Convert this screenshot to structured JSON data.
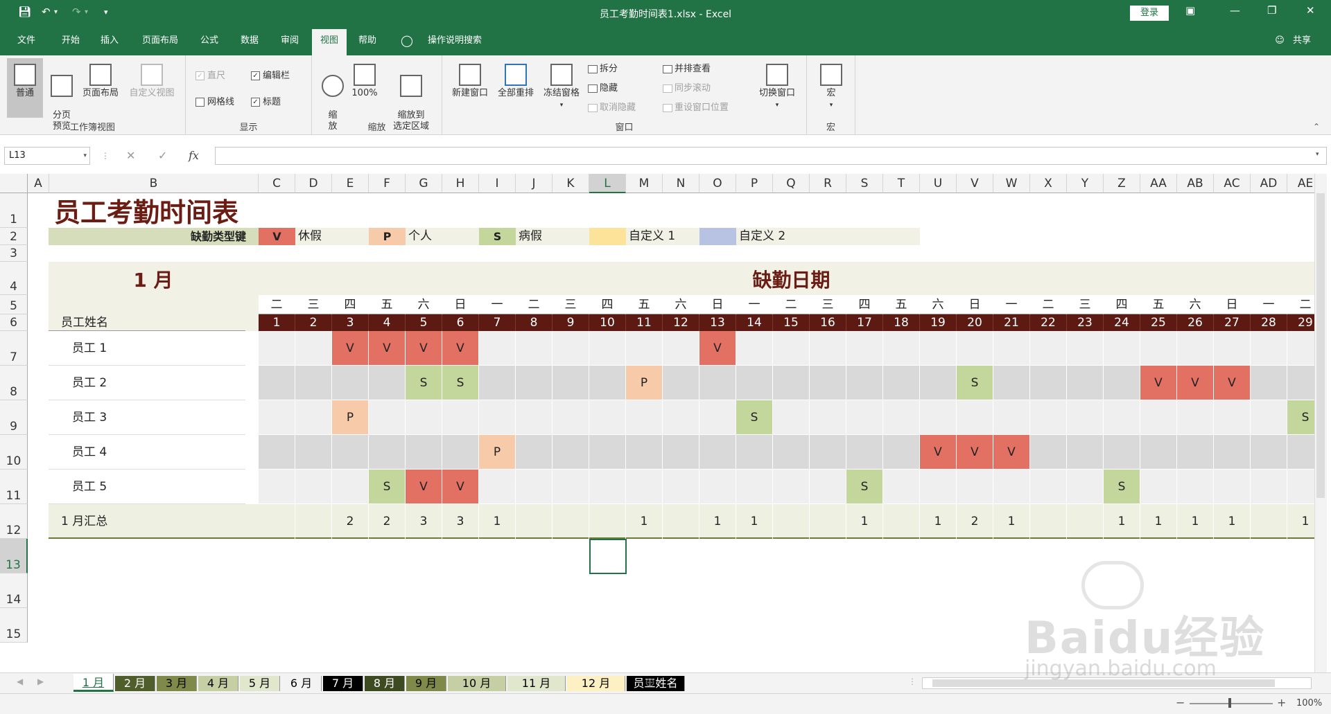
{
  "window": {
    "title": "员工考勤时间表1.xlsx  -  Excel",
    "login": "登录",
    "share": "共享"
  },
  "ribbon_tabs": [
    "文件",
    "开始",
    "插入",
    "页面布局",
    "公式",
    "数据",
    "审阅",
    "视图",
    "帮助"
  ],
  "tell_me": "操作说明搜索",
  "ribbon": {
    "workbook_views": {
      "label": "工作簿视图",
      "normal": "普通",
      "page_break": "分页\n预览",
      "page_layout": "页面布局",
      "custom_views": "自定义视图"
    },
    "show": {
      "label": "显示",
      "ruler": "直尺",
      "formula_bar": "编辑栏",
      "gridlines": "网格线",
      "headings": "标题"
    },
    "zoom": {
      "label": "缩放",
      "zoom": "缩\n放",
      "zoom100": "100%",
      "zoom_sel": "缩放到\n选定区域"
    },
    "window": {
      "label": "窗口",
      "new_window": "新建窗口",
      "arrange_all": "全部重排",
      "freeze": "冻结窗格",
      "split": "拆分",
      "hide": "隐藏",
      "unhide": "取消隐藏",
      "side_by_side": "并排查看",
      "sync_scroll": "同步滚动",
      "reset_pos": "重设窗口位置",
      "switch": "切换窗口"
    },
    "macros": {
      "label": "宏",
      "macros": "宏"
    }
  },
  "formula_bar": {
    "name_box": "L13",
    "fx": "fx",
    "value": ""
  },
  "sheet": {
    "columns": [
      "A",
      "B",
      "C",
      "D",
      "E",
      "F",
      "G",
      "H",
      "I",
      "J",
      "K",
      "L",
      "M",
      "N",
      "O",
      "P",
      "Q",
      "R",
      "S",
      "T",
      "U",
      "V",
      "W",
      "X",
      "Y",
      "Z",
      "AA",
      "AB",
      "AC",
      "AD",
      "AE"
    ],
    "rows": [
      "1",
      "2",
      "3",
      "4",
      "5",
      "6",
      "7",
      "8",
      "9",
      "10",
      "11",
      "12",
      "13",
      "14",
      "15"
    ],
    "selected_col": "L",
    "selected_row": "13",
    "title": "员工考勤时间表",
    "legend": {
      "label": "缺勤类型键",
      "items": [
        {
          "code": "V",
          "name": "休假",
          "color": "#e27063"
        },
        {
          "code": "P",
          "name": "个人",
          "color": "#f7cba9"
        },
        {
          "code": "S",
          "name": "病假",
          "color": "#c3d69b"
        },
        {
          "code": "",
          "name": "自定义 1",
          "color": "#fde29a"
        },
        {
          "code": "",
          "name": "自定义 2",
          "color": "#b8c2e3"
        }
      ]
    },
    "month": "1 月",
    "absence_title": "缺勤日期",
    "name_header": "员工姓名",
    "weekdays": [
      "二",
      "三",
      "四",
      "五",
      "六",
      "日",
      "一",
      "二",
      "三",
      "四",
      "五",
      "六",
      "日",
      "一",
      "二",
      "三",
      "四",
      "五",
      "六",
      "日",
      "一",
      "二",
      "三",
      "四",
      "五",
      "六",
      "日",
      "一",
      "二"
    ],
    "days": [
      "1",
      "2",
      "3",
      "4",
      "5",
      "6",
      "7",
      "8",
      "9",
      "10",
      "11",
      "12",
      "13",
      "14",
      "15",
      "16",
      "17",
      "18",
      "19",
      "20",
      "21",
      "22",
      "23",
      "24",
      "25",
      "26",
      "27",
      "28",
      "29"
    ],
    "employees": [
      {
        "name": "员工 1",
        "marks": {
          "3": "V",
          "4": "V",
          "5": "V",
          "6": "V",
          "13": "V"
        }
      },
      {
        "name": "员工 2",
        "marks": {
          "5": "S",
          "6": "S",
          "11": "P",
          "20": "S",
          "25": "V",
          "26": "V",
          "27": "V"
        }
      },
      {
        "name": "员工 3",
        "marks": {
          "3": "P",
          "14": "S",
          "29": "S"
        }
      },
      {
        "name": "员工 4",
        "marks": {
          "7": "P",
          "19": "V",
          "20": "V",
          "21": "V"
        }
      },
      {
        "name": "员工 5",
        "marks": {
          "4": "S",
          "5": "V",
          "6": "V",
          "17": "S",
          "24": "S"
        }
      }
    ],
    "summary_label": "1 月汇总",
    "summary": {
      "3": "2",
      "4": "2",
      "5": "3",
      "6": "3",
      "7": "1",
      "11": "1",
      "13": "1",
      "14": "1",
      "17": "1",
      "19": "1",
      "20": "2",
      "21": "1",
      "24": "1",
      "25": "1",
      "26": "1",
      "27": "1",
      "29": "1"
    }
  },
  "sheet_tabs": [
    {
      "name": "1 月",
      "bg": "#ffffff",
      "fg": "#217346",
      "active": true
    },
    {
      "name": "2 月",
      "bg": "#4f5e2a",
      "fg": "#ffffff"
    },
    {
      "name": "3 月",
      "bg": "#7f8a4a",
      "fg": "#000000"
    },
    {
      "name": "4 月",
      "bg": "#c6cfa3",
      "fg": "#000000"
    },
    {
      "name": "5 月",
      "bg": "#e1e7cc",
      "fg": "#000000"
    },
    {
      "name": "6 月",
      "bg": "#f3f3f3",
      "fg": "#000000"
    },
    {
      "name": "7 月",
      "bg": "#000000",
      "fg": "#ffffff"
    },
    {
      "name": "8 月",
      "bg": "#3e4a20",
      "fg": "#ffffff"
    },
    {
      "name": "9 月",
      "bg": "#7f8a4a",
      "fg": "#000000"
    },
    {
      "name": "10 月",
      "bg": "#c6cfa3",
      "fg": "#000000"
    },
    {
      "name": "11 月",
      "bg": "#e1e7cc",
      "fg": "#000000"
    },
    {
      "name": "12 月",
      "bg": "#fdf1c4",
      "fg": "#000000"
    },
    {
      "name": "员工姓名",
      "bg": "#000000",
      "fg": "#ffffff"
    }
  ],
  "status": {
    "zoom": "100%"
  },
  "watermark": {
    "brand": "Baidu经验",
    "url": "jingyan.baidu.com"
  }
}
